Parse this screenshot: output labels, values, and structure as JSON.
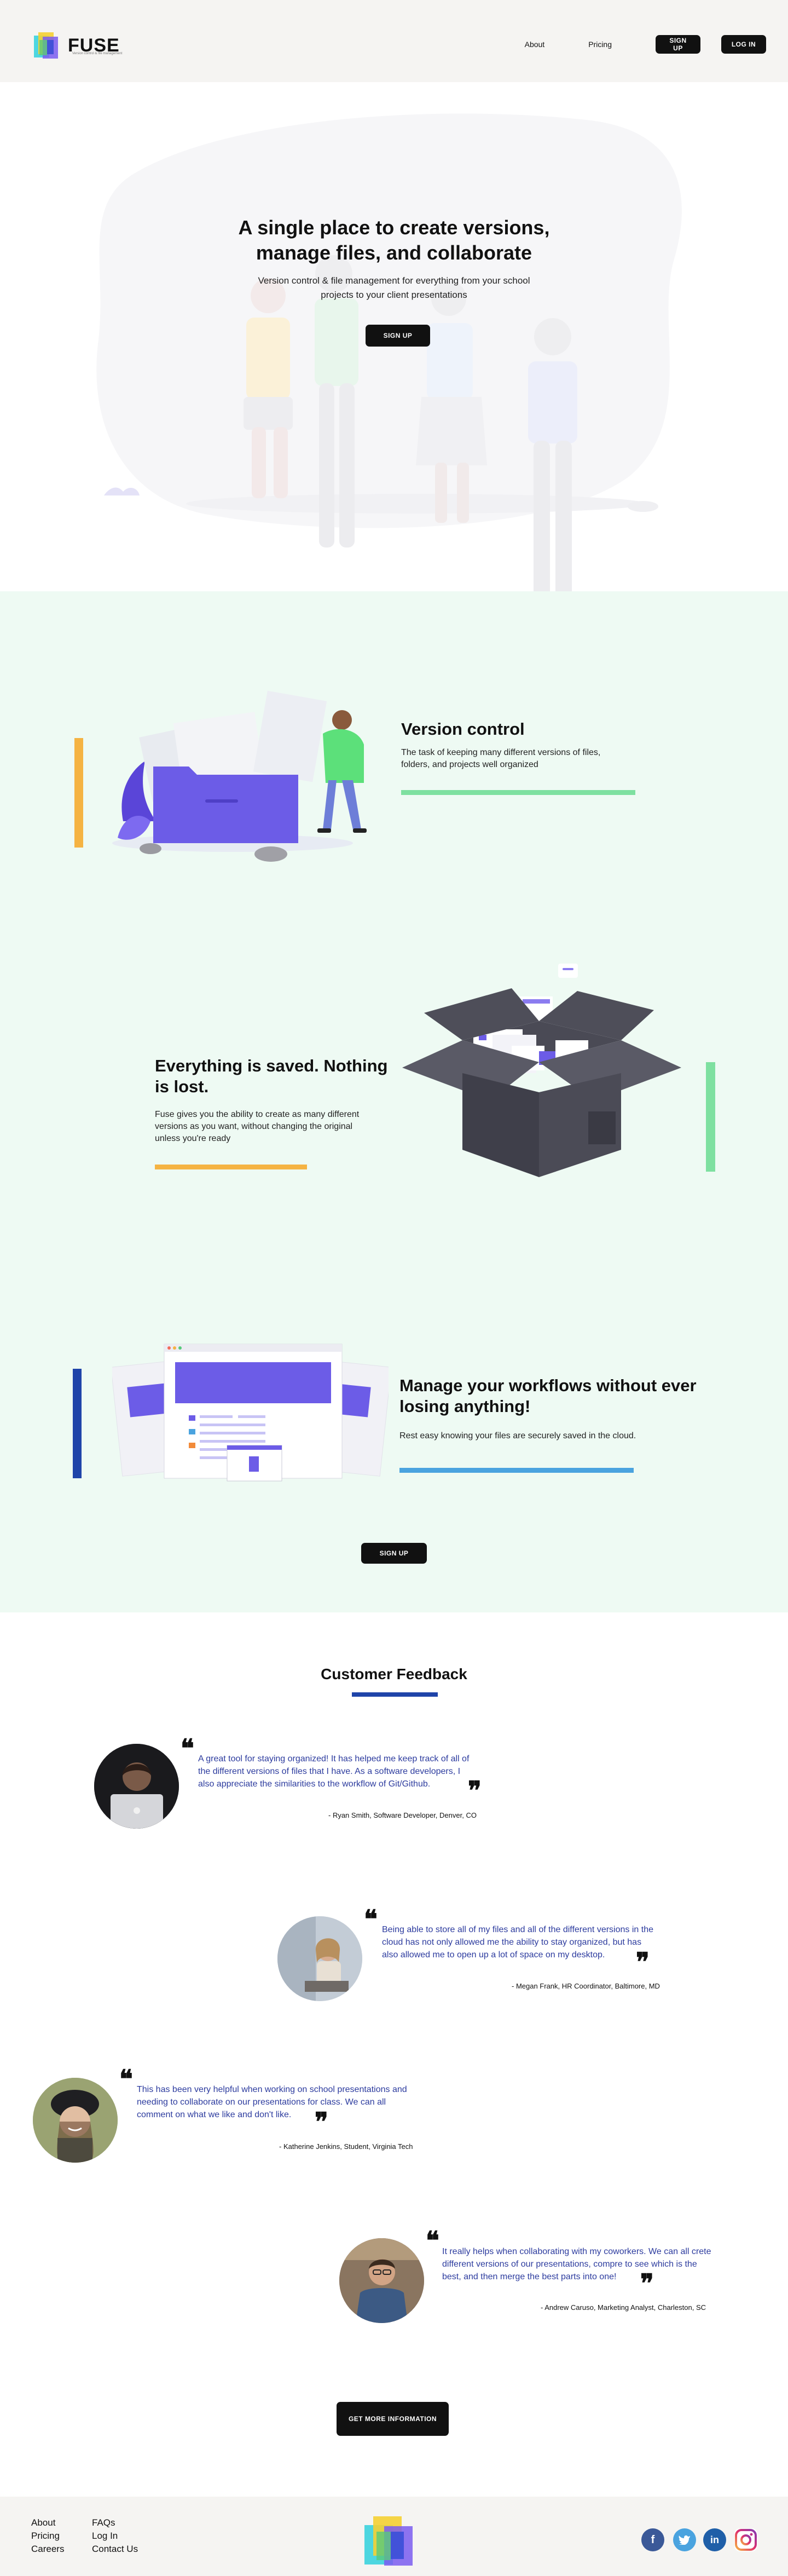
{
  "header": {
    "brand": "FUSE",
    "brand_tagline": "Version control & file management",
    "nav": {
      "about": "About",
      "pricing": "Pricing",
      "signup": "SIGN UP",
      "login": "LOG IN"
    }
  },
  "hero": {
    "title_line1": "A single place to create versions,",
    "title_line2": "manage files, and collaborate",
    "subtitle_line1": "Version control & file management for everything from your school",
    "subtitle_line2": "projects to your client presentations",
    "cta": "SIGN UP"
  },
  "features": [
    {
      "title": "Version control",
      "desc_line1": "The task of keeping many different versions of files,",
      "desc_line2": "folders, and projects well organized",
      "underline_color": "#7ee0a0",
      "side_bar_color": "#f5b342"
    },
    {
      "title_line1": "Everything is saved. Nothing",
      "title_line2": "is lost.",
      "desc_line1": "Fuse gives you the ability to create as many different",
      "desc_line2": "versions as you want, without changing the original",
      "desc_line3": "unless you're ready",
      "underline_color": "#f5b342",
      "side_bar_color": "#7ee0a0"
    },
    {
      "title_line1": "Manage your workflows without ever",
      "title_line2": "losing anything!",
      "desc_line1": "Rest easy knowing your files are securely saved in the cloud.",
      "underline_color": "#4aa3df",
      "side_bar_color": "#1f44a9"
    }
  ],
  "features_cta": "SIGN UP",
  "feedback": {
    "heading": "Customer Feedback",
    "testimonials": [
      {
        "line1": "A great tool for staying organized! It has helped me keep track of all of",
        "line2": "the different versions of files that I have. As a software developers, I",
        "line3": "also appreciate the similarities to the workflow of Git/Github.",
        "author": "- Ryan Smith, Software Developer, Denver, CO"
      },
      {
        "line1": "Being able to store all of my files and all of the different versions in the",
        "line2": "cloud has not only allowed me the ability to stay organized, but has",
        "line3": "also allowed me to open up a lot of space on my desktop.",
        "author": "- Megan Frank, HR Coordinator, Baltimore, MD"
      },
      {
        "line1": "This has been very helpful when working on school presentations and",
        "line2": "needing to collaborate on our presentations for class. We can all",
        "line3": "comment on what we like and don't like.",
        "author": "- Katherine Jenkins, Student, Virginia Tech"
      },
      {
        "line1": "It really helps when collaborating with my coworkers. We can all crete",
        "line2": "different versions of our presentations, compre to see which is the",
        "line3": "best, and then merge the best parts into one!",
        "author": "- Andrew Caruso, Marketing Analyst, Charleston, SC"
      }
    ],
    "cta": "GET MORE INFORMATION"
  },
  "footer": {
    "links_col1": [
      "About",
      "Pricing",
      "Careers"
    ],
    "links_col2": [
      "FAQs",
      "Log In",
      "Contact Us"
    ],
    "social": [
      "facebook-icon",
      "twitter-icon",
      "linkedin-icon",
      "instagram-icon"
    ]
  },
  "colors": {
    "dark": "#111111",
    "mint_bg": "#eefaf3",
    "purple": "#6c5ce7",
    "quote_blue": "#2c3b9e",
    "navy": "#1f44a9"
  }
}
